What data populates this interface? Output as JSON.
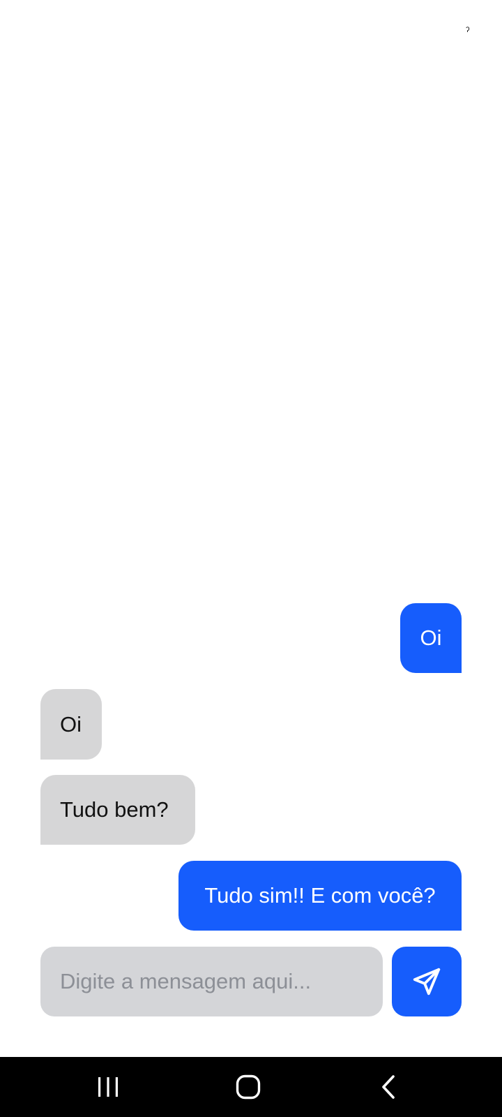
{
  "status_bar": {
    "indicator": "ˀ"
  },
  "messages": [
    {
      "text": "Oi",
      "direction": "sent"
    },
    {
      "text": "Oi",
      "direction": "received"
    },
    {
      "text": "Tudo bem?",
      "direction": "received"
    },
    {
      "text": "Tudo sim!! E com você?",
      "direction": "sent"
    }
  ],
  "composer": {
    "placeholder": "Digite a mensagem aqui...",
    "value": "",
    "send_icon": "send-icon"
  },
  "navigation": {
    "recent_icon": "recent-apps-icon",
    "home_icon": "home-icon",
    "back_icon": "back-icon"
  },
  "colors": {
    "sent_bubble": "#165dfc",
    "received_bubble": "#d6d6d7",
    "input_background": "#d4d5d8",
    "nav_bar": "#000000"
  }
}
